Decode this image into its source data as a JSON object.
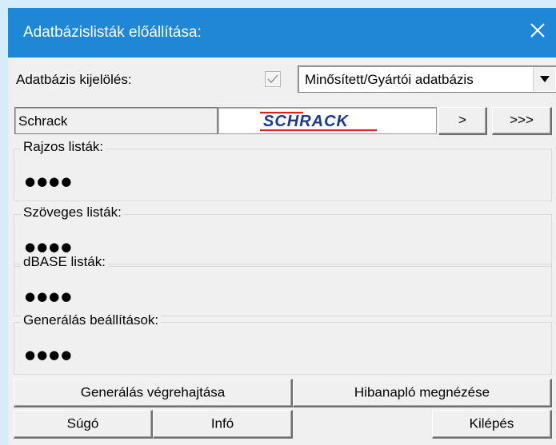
{
  "window": {
    "title": "Adatbázislisták előállítása:"
  },
  "database": {
    "label": "Adatbázis kijelölés:",
    "checked": true,
    "selected_value": "Minősített/Gyártói adatbázis"
  },
  "manufacturer": {
    "name": "Schrack",
    "logo_text": "SCHRACK",
    "logo_color": "#1c3a8c",
    "logo_accent_color": "#d9261c",
    "next_label": ">",
    "last_label": ">>>"
  },
  "groups": [
    {
      "label": "Rajzos listák:",
      "value": "●●●●"
    },
    {
      "label": "Szöveges listák:",
      "value": "●●●●"
    },
    {
      "label": "dBASE listák:",
      "value": "●●●●"
    },
    {
      "label": "Generálás beállítások:",
      "value": "●●●●"
    }
  ],
  "buttons": {
    "generate": "Generálás végrehajtása",
    "error_log": "Hibanapló megnézése",
    "help": "Súgó",
    "info": "Infó",
    "exit": "Kilépés"
  },
  "colors": {
    "titlebar": "#1e88d6",
    "background": "#d5ecfa"
  },
  "icons": {
    "close": "close-icon",
    "checkbox": "checkmark-icon",
    "dropdown": "chevron-down-icon"
  }
}
